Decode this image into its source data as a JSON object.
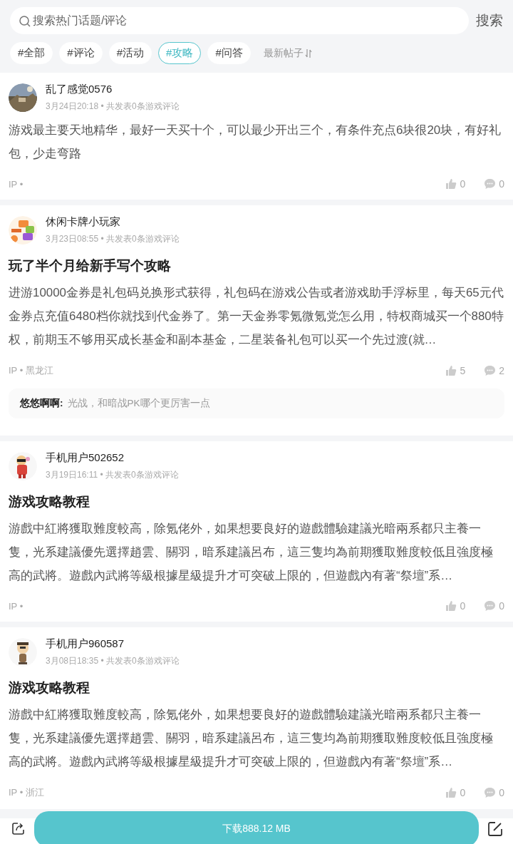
{
  "search": {
    "placeholder": "搜索热门话题/评论",
    "button": "搜索"
  },
  "filters": [
    {
      "label": "#全部",
      "selected": false
    },
    {
      "label": "#评论",
      "selected": false
    },
    {
      "label": "#活动",
      "selected": false
    },
    {
      "label": "#攻略",
      "selected": true
    },
    {
      "label": "#问答",
      "selected": false
    }
  ],
  "sort": {
    "label": "最新帖子"
  },
  "posts": [
    {
      "author": "乱了感觉0576",
      "meta": "3月24日20:18 • 共发表0条游戏评论",
      "body": "游戏最主要天地精华，最好一天买十个，可以最少开出三个，有条件充点6块很20块，有好礼包，少走弯路",
      "ip": "IP •",
      "likes": "0",
      "comments": "0"
    },
    {
      "author": "休闲卡牌小玩家",
      "meta": "3月23日08:55 • 共发表0条游戏评论",
      "title": "玩了半个月给新手写个攻略",
      "body": "进游10000金券是礼包码兑换形式获得，礼包码在游戏公告或者游戏助手浮标里，每天65元代金券点充值6480档你就找到代金券了。第一天金券零氪微氪党怎么用，特权商城买一个880特权，前期玉不够用买成长基金和副本基金，二星装备礼包可以买一个先过渡(就…",
      "ip": "IP • 黑龙江",
      "likes": "5",
      "comments": "2",
      "reply": {
        "author": "悠悠啊啊:",
        "text": "光战，和暗战PK哪个更厉害一点"
      }
    },
    {
      "author": "手机用户502652",
      "meta": "3月19日16:11 • 共发表0条游戏评论",
      "title": "游戏攻略教程",
      "body": "游戲中紅將獲取難度較高，除氪佬外，如果想要良好的遊戲體驗建議光暗兩系都只主養一隻，光系建議優先選擇趙雲、關羽，暗系建議呂布，這三隻均為前期獲取難度較低且強度極高的武將。遊戲內武將等級根據星級提升才可突破上限的，但遊戲內有著“祭壇”系…",
      "ip": "IP •",
      "likes": "0",
      "comments": "0"
    },
    {
      "author": "手机用户960587",
      "meta": "3月08日18:35 • 共发表0条游戏评论",
      "title": "游戏攻略教程",
      "body": "游戲中紅將獲取難度較高，除氪佬外，如果想要良好的遊戲體驗建議光暗兩系都只主養一隻，光系建議優先選擇趙雲、關羽，暗系建議呂布，這三隻均為前期獲取難度較低且強度極高的武將。遊戲內武將等級根據星級提升才可突破上限的，但遊戲內有著“祭壇”系…",
      "ip": "IP • 浙江",
      "likes": "0",
      "comments": "0"
    }
  ],
  "download": {
    "label": "下载888.12 MB"
  }
}
